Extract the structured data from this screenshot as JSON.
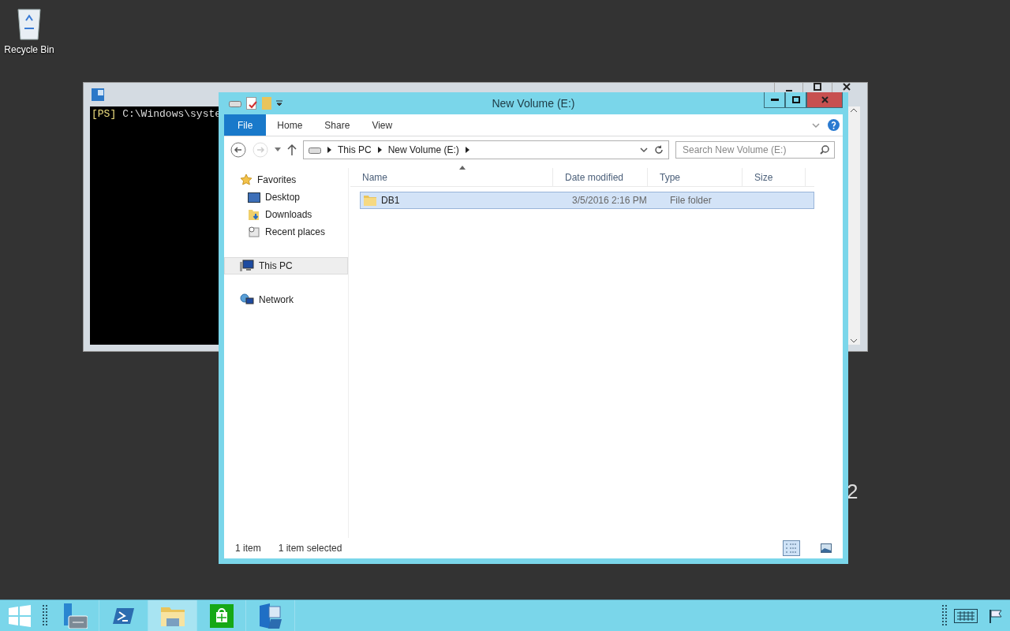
{
  "desktop": {
    "icons": [
      {
        "label": "Recycle Bin"
      }
    ],
    "watermark_fragment": "2"
  },
  "console_window": {
    "prompt_tag": "[PS]",
    "prompt_text": "C:\\Windows\\syste"
  },
  "explorer": {
    "title": "New Volume (E:)",
    "ribbon_tabs": [
      {
        "label": "File",
        "kind": "file"
      },
      {
        "label": "Home",
        "kind": "tab"
      },
      {
        "label": "Share",
        "kind": "tab"
      },
      {
        "label": "View",
        "kind": "tab"
      }
    ],
    "breadcrumb": [
      "This PC",
      "New Volume (E:)"
    ],
    "search": {
      "placeholder": "Search New Volume (E:)"
    },
    "nav": [
      {
        "label": "Favorites",
        "kind": "star",
        "selected": false,
        "children": [
          {
            "label": "Desktop",
            "kind": "desktop",
            "selected": false
          },
          {
            "label": "Downloads",
            "kind": "downloads",
            "selected": false
          },
          {
            "label": "Recent places",
            "kind": "recent",
            "selected": false
          }
        ]
      },
      {
        "label": "This PC",
        "kind": "pc",
        "selected": true
      },
      {
        "label": "Network",
        "kind": "network",
        "selected": false
      }
    ],
    "columns": [
      "Name",
      "Date modified",
      "Type",
      "Size"
    ],
    "rows": [
      {
        "name": "DB1",
        "date": "3/5/2016 2:16 PM",
        "type": "File folder",
        "selected": true
      }
    ],
    "status": {
      "count": "1 item",
      "selection": "1 item selected"
    },
    "views": [
      {
        "kind": "details",
        "selected": true
      },
      {
        "kind": "tiles",
        "selected": false
      }
    ]
  },
  "taskbar": {
    "apps": [
      {
        "kind": "server",
        "selected": false
      },
      {
        "kind": "powershell",
        "selected": false
      },
      {
        "kind": "explorer",
        "selected": true
      },
      {
        "kind": "store",
        "selected": false
      },
      {
        "kind": "exchange",
        "selected": false
      }
    ]
  }
}
